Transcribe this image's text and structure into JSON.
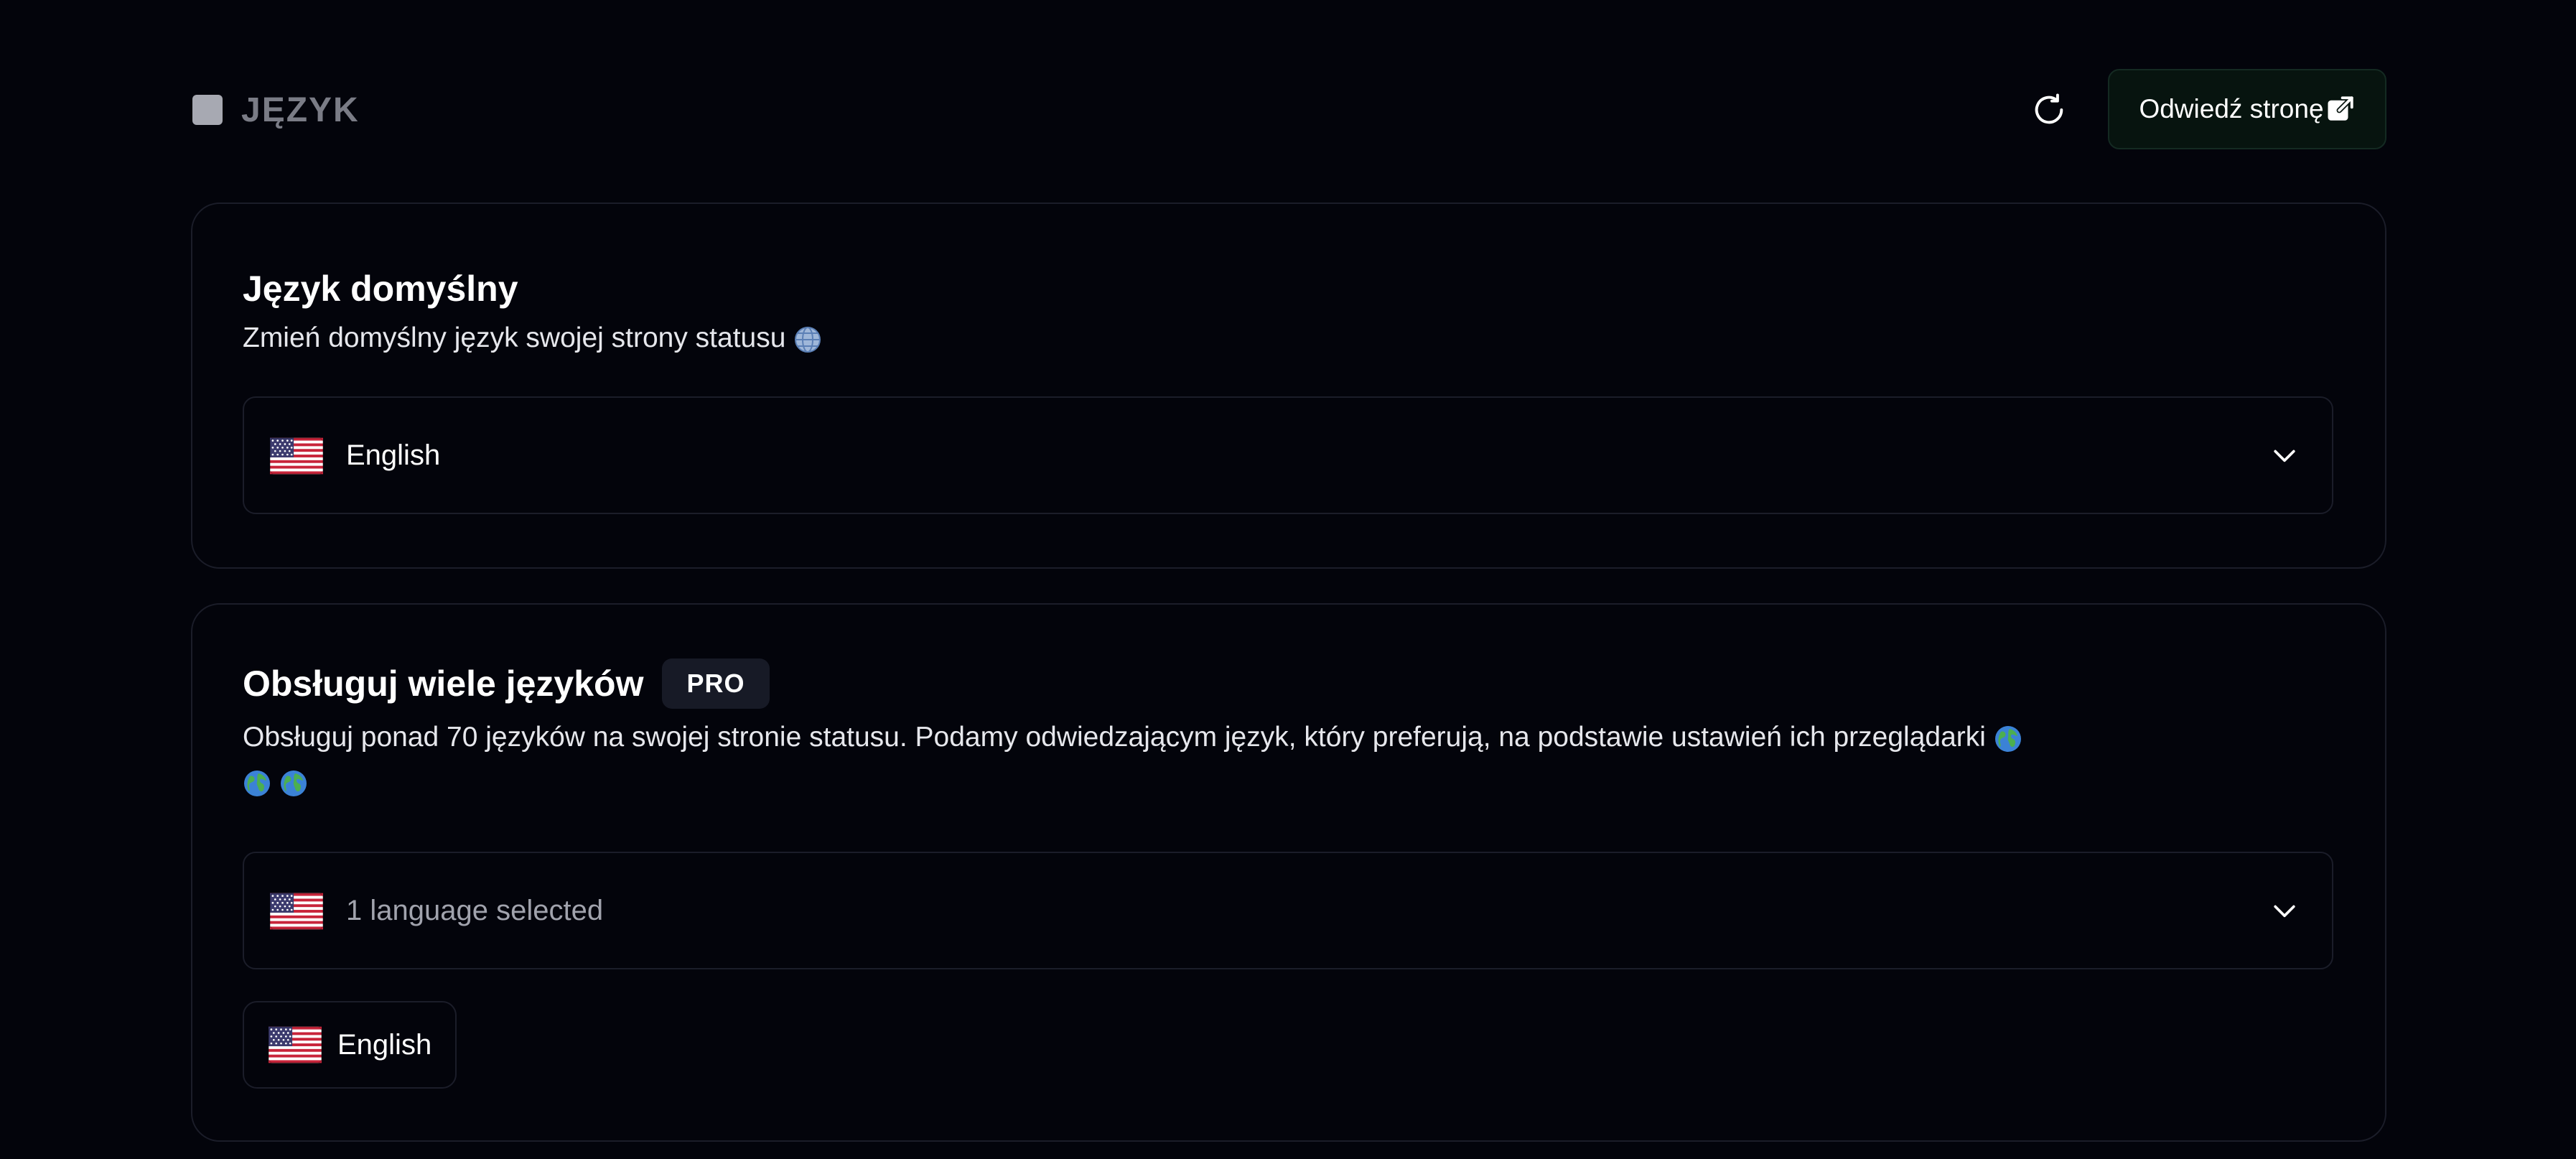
{
  "header": {
    "title": "JĘZYK",
    "refresh_icon": "refresh-icon",
    "visit_label": "Odwiedź stronę",
    "visit_icon": "external-link-icon"
  },
  "default_language": {
    "title": "Język domyślny",
    "description": "Zmień domyślny język swojej strony statusu",
    "description_icon": "globe-icon",
    "select": {
      "value": "English",
      "flag": "us-flag-icon"
    }
  },
  "multi_language": {
    "title": "Obsługuj wiele języków",
    "badge": "PRO",
    "description": "Obsługuj ponad 70 języków na swojej stronie statusu. Podamy odwiedzającym język, który preferują, na podstawie ustawień ich przeglądarki",
    "description_icons": [
      "globe-africa-icon",
      "globe-americas-icon",
      "globe-asia-icon"
    ],
    "select": {
      "placeholder": "1 language selected",
      "flag": "us-flag-icon"
    },
    "selected_chips": [
      {
        "label": "English",
        "flag": "us-flag-icon"
      }
    ]
  },
  "colors": {
    "background": "#03040b",
    "card_border": "#1b1d29",
    "visit_button_bg": "#07140f",
    "badge_bg": "#171a26"
  }
}
